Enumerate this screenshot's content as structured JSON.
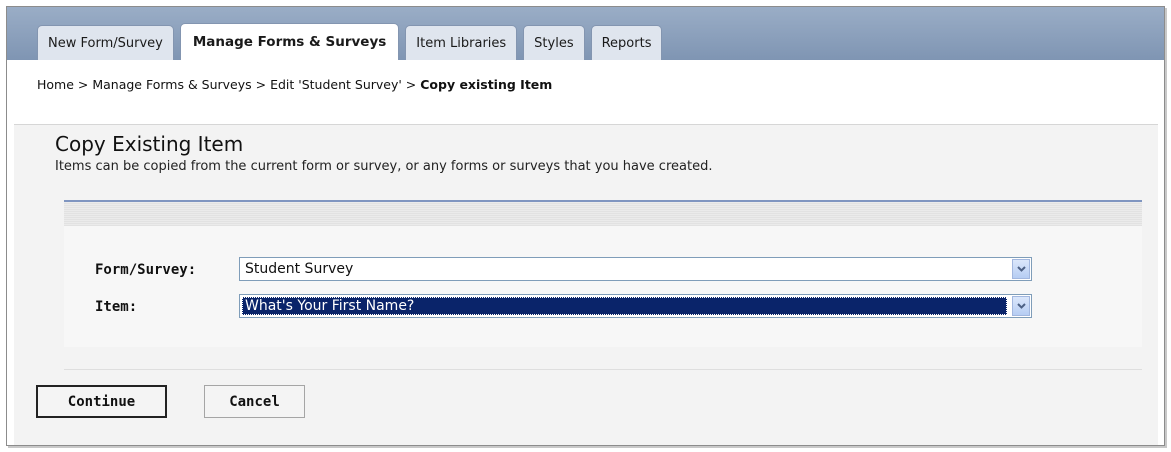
{
  "tabs": [
    {
      "label": "New Form/Survey"
    },
    {
      "label": "Manage Forms & Surveys",
      "active": true
    },
    {
      "label": "Item Libraries"
    },
    {
      "label": "Styles"
    },
    {
      "label": "Reports"
    }
  ],
  "breadcrumb": {
    "home": "Home",
    "sep": " > ",
    "manage": "Manage Forms & Surveys",
    "edit": "Edit 'Student Survey'",
    "current": "Copy existing Item"
  },
  "panel": {
    "title": "Copy Existing Item",
    "description": "Items can be copied from the current form or survey, or any forms or surveys that you have created."
  },
  "form": {
    "form_survey_label": "Form/Survey:",
    "form_survey_value": "Student Survey",
    "item_label": "Item:",
    "item_value": "What's Your First Name?"
  },
  "buttons": {
    "continue": "Continue",
    "cancel": "Cancel"
  },
  "colors": {
    "tabbar": "#8a9dbb",
    "selection": "#0a246a",
    "rule": "#7f95c0"
  }
}
